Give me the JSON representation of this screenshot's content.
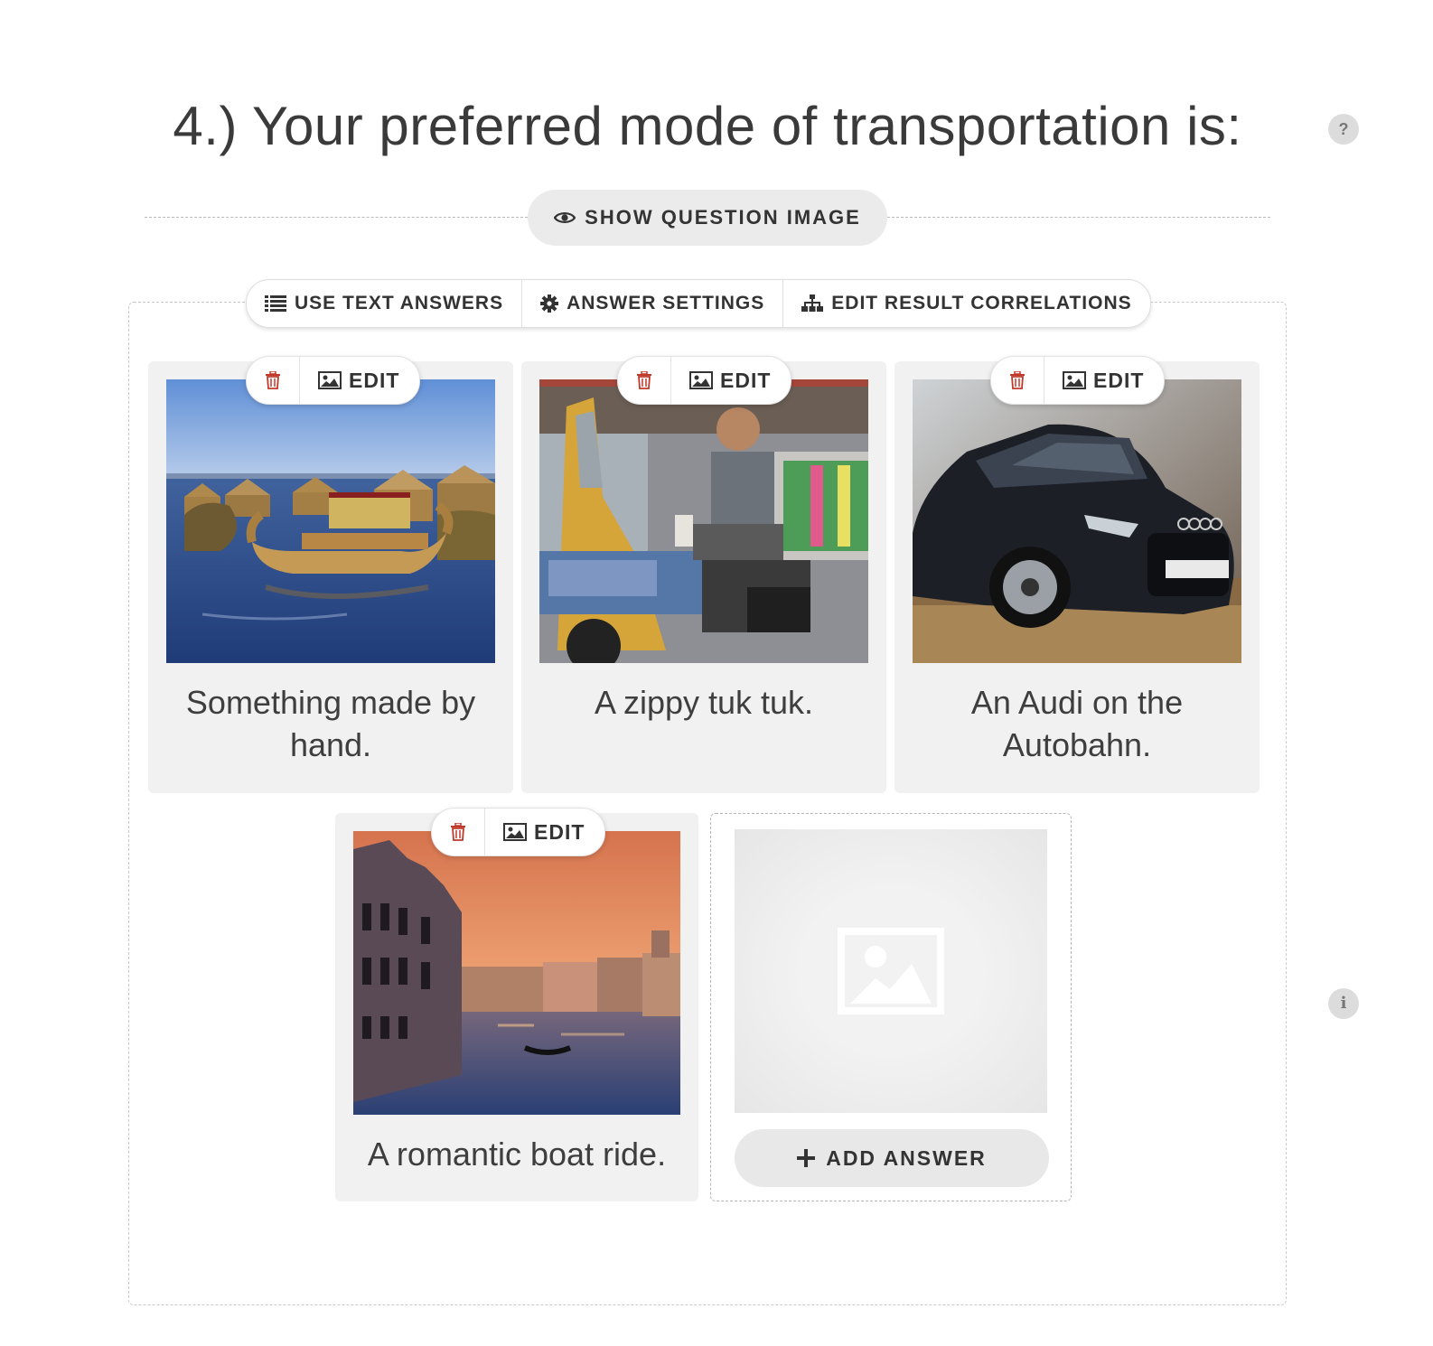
{
  "question": {
    "title": "4.) Your preferred mode of transportation is:",
    "help_icon": "question-mark-icon",
    "info_icon": "info-icon"
  },
  "show_question_image": {
    "label": "SHOW QUESTION IMAGE",
    "icon": "eye-icon"
  },
  "toolbar": {
    "use_text_answers": "USE TEXT ANSWERS",
    "answer_settings": "ANSWER SETTINGS",
    "edit_result_correlations": "EDIT RESULT CORRELATIONS"
  },
  "answers": [
    {
      "caption": "Something made by hand.",
      "edit_label": "EDIT",
      "image": "reed-boat-lake-photo"
    },
    {
      "caption": "A zippy tuk tuk.",
      "edit_label": "EDIT",
      "image": "tuk-tuk-driver-photo"
    },
    {
      "caption": "An Audi on the Autobahn.",
      "edit_label": "EDIT",
      "image": "black-audi-car-photo"
    },
    {
      "caption": "A romantic boat ride.",
      "edit_label": "EDIT",
      "image": "venice-canal-sunset-photo"
    }
  ],
  "add_answer": {
    "label": "ADD ANSWER",
    "icon": "plus-icon"
  },
  "colors": {
    "trash": "#c0392b",
    "card_bg": "#f1f1f1",
    "text": "#333333"
  }
}
